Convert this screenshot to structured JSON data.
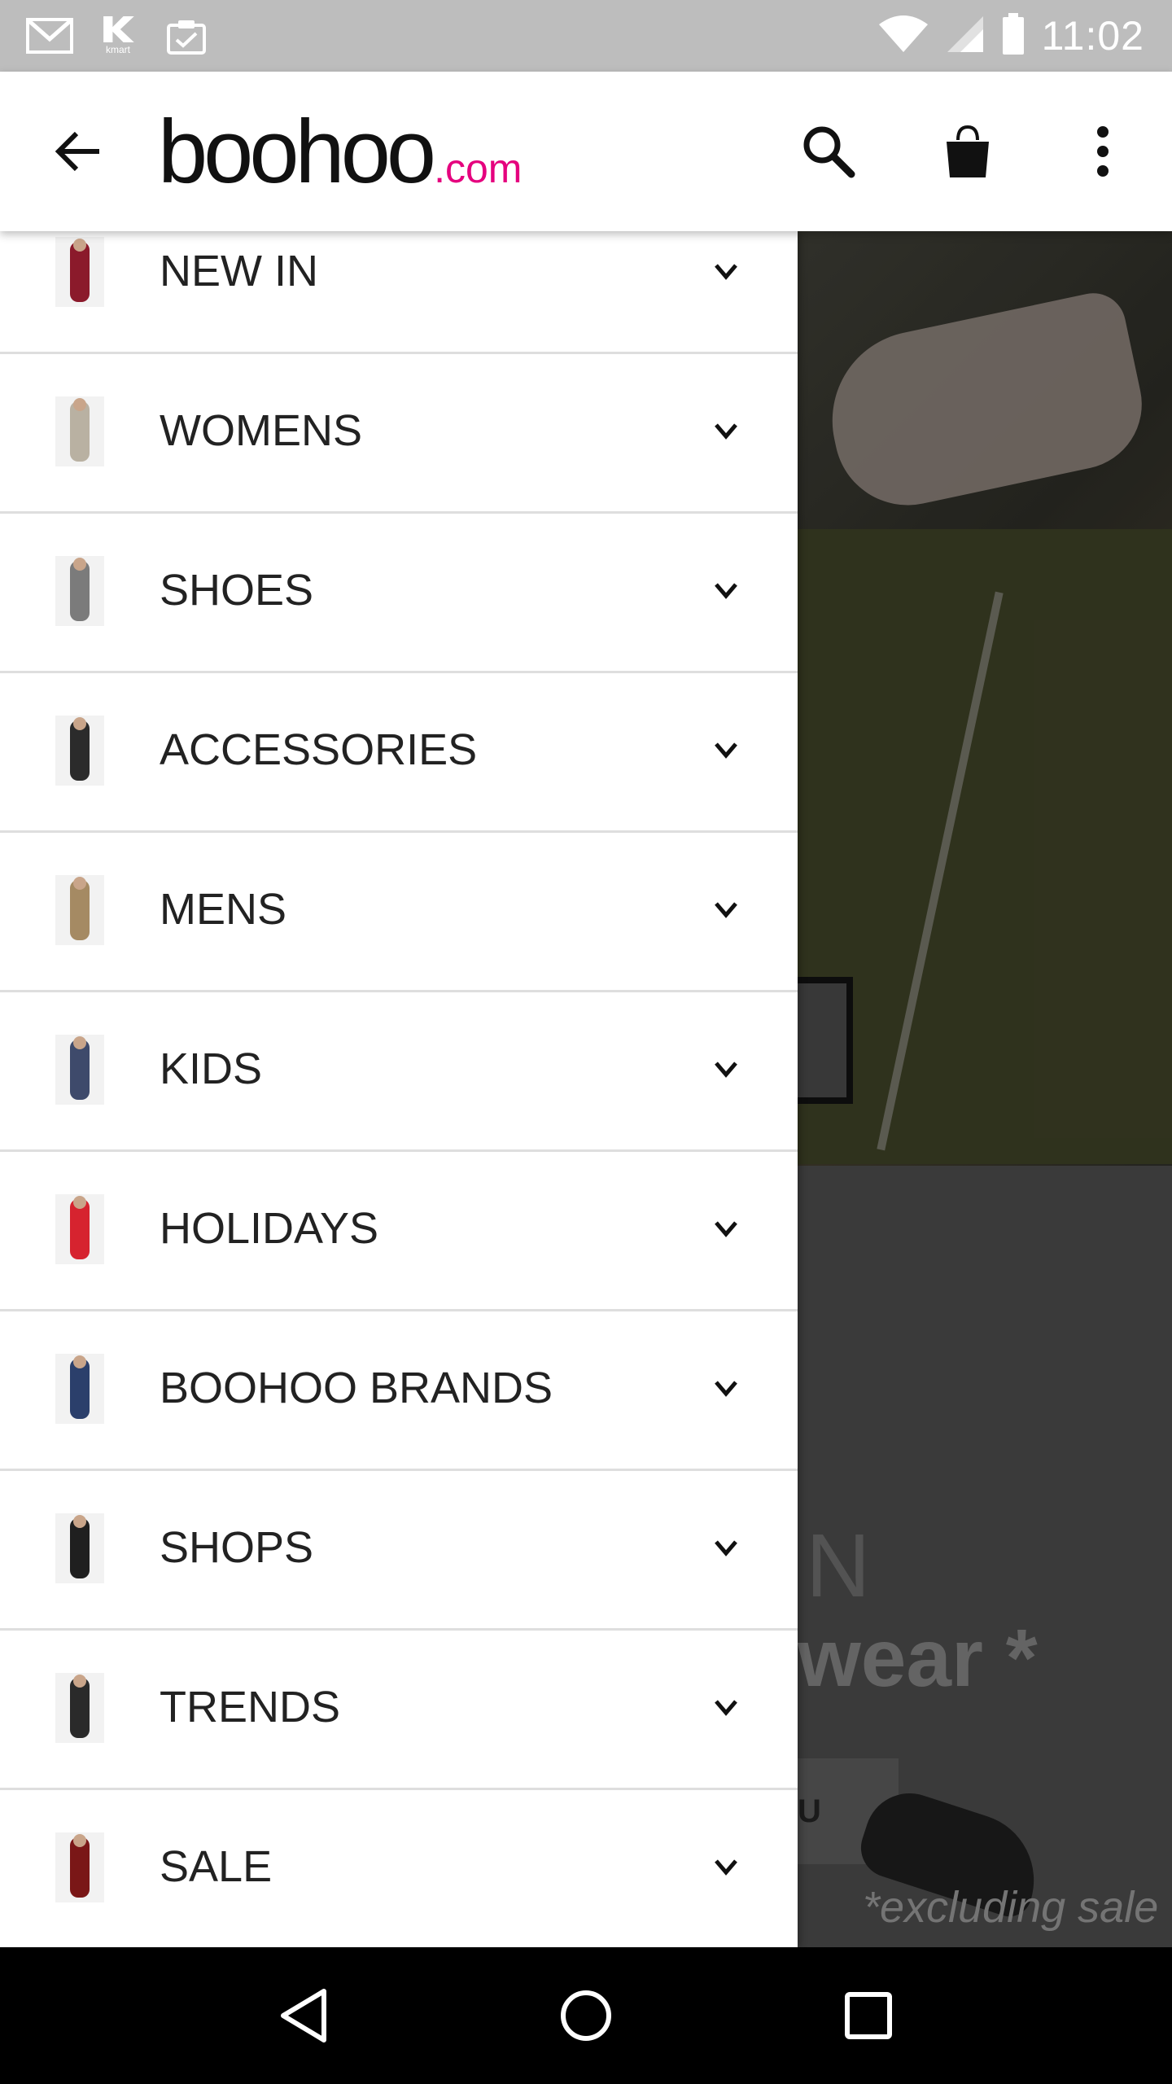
{
  "status_bar": {
    "time": "11:02",
    "kmart_label": "kmart",
    "left_icons": [
      "gmail-icon",
      "kmart-icon",
      "clipboard-check-icon"
    ],
    "right_icons": [
      "wifi-icon",
      "signal-icon",
      "battery-icon"
    ]
  },
  "app_bar": {
    "logo_main": "boohoo",
    "logo_domain": ".com",
    "logo_domain_color": "#e5007e",
    "icons": [
      "back-arrow-icon",
      "search-icon",
      "shopping-bag-icon",
      "more-vert-icon"
    ]
  },
  "menu": {
    "items": [
      {
        "label": "NEW IN",
        "thumb_color": "#8b1a2b"
      },
      {
        "label": "WOMENS",
        "thumb_color": "#b9b1a2"
      },
      {
        "label": "SHOES",
        "thumb_color": "#7b7b7b"
      },
      {
        "label": "ACCESSORIES",
        "thumb_color": "#2b2b2b"
      },
      {
        "label": "MENS",
        "thumb_color": "#a58a63"
      },
      {
        "label": "KIDS",
        "thumb_color": "#3e4a6b"
      },
      {
        "label": "HOLIDAYS",
        "thumb_color": "#d6232f"
      },
      {
        "label": "BOOHOO BRANDS",
        "thumb_color": "#2b3f6b"
      },
      {
        "label": "SHOPS",
        "thumb_color": "#1f1f1f"
      },
      {
        "label": "TRENDS",
        "thumb_color": "#2a2a2a"
      },
      {
        "label": "SALE",
        "thumb_color": "#7a1717"
      }
    ]
  },
  "background": {
    "partial_text_n": "N",
    "partial_text_wear": "wear *",
    "partial_button": "U",
    "footnote": "*excluding sale"
  },
  "nav_bar": {
    "icons": [
      "back-triangle-icon",
      "home-circle-icon",
      "recents-square-icon"
    ]
  }
}
